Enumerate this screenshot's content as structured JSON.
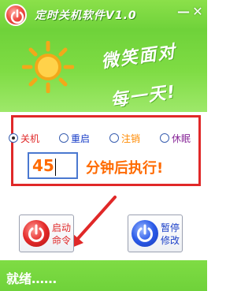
{
  "window": {
    "title": "定时关机软件V1.0",
    "minimize_glyph": "—",
    "close_glyph": "✕"
  },
  "banner": {
    "slogan_line1": "微笑面对",
    "slogan_line2": "每一天!",
    "sun_icon": "sun-icon"
  },
  "options": {
    "items": [
      {
        "label": "关机",
        "selected": true,
        "color": "#e02828"
      },
      {
        "label": "重启",
        "selected": false,
        "color": "#1a3fc8"
      },
      {
        "label": "注销",
        "selected": false,
        "color": "#ff8a00"
      },
      {
        "label": "休眠",
        "selected": false,
        "color": "#8a2a9a"
      }
    ],
    "minutes_value": "45",
    "minutes_suffix": "分钟后执行!"
  },
  "actions": {
    "start": {
      "line1": "启动",
      "line2": "命令",
      "icon": "power-icon",
      "color": "#e02828"
    },
    "pause": {
      "line1": "暂停",
      "line2": "修改",
      "icon": "power-icon",
      "color": "#1a3fc8"
    }
  },
  "status": {
    "text": "就绪……"
  },
  "colors": {
    "accent_green": "#6fd23a",
    "panel_border": "#e02828",
    "highlight_orange": "#ff6a00"
  }
}
